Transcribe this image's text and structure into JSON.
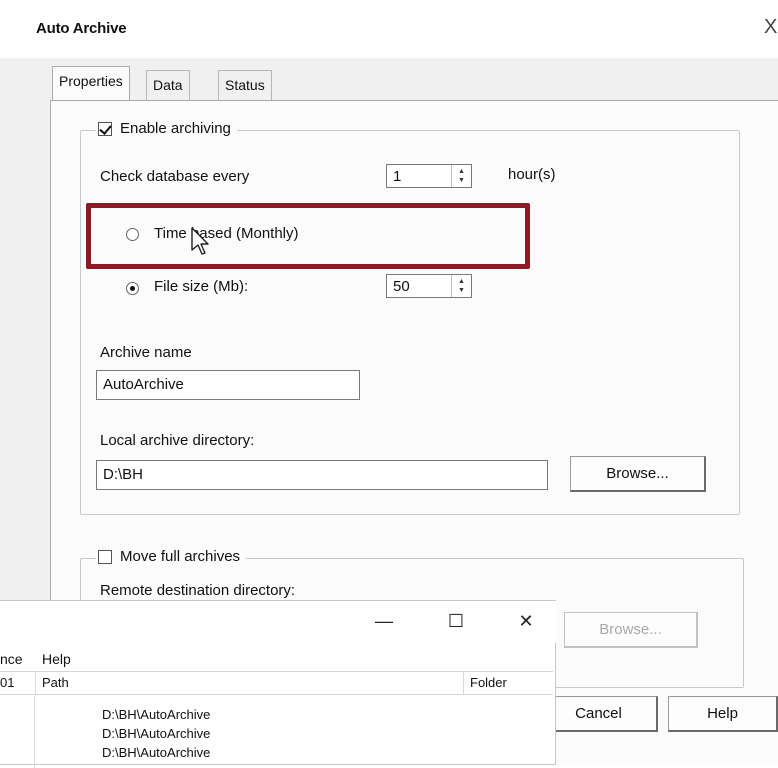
{
  "dialog": {
    "title": "Auto Archive",
    "close_glyph": "X",
    "tabs": [
      {
        "label": "Properties",
        "active": true
      },
      {
        "label": "Data",
        "active": false
      },
      {
        "label": "Status",
        "active": false
      }
    ],
    "archiving": {
      "enable_label": "Enable archiving",
      "enable_checked": true,
      "check_label": "Check database every",
      "check_value": "1",
      "check_unit": "hour(s)",
      "time_based_label": "Time based (Monthly)",
      "time_based_selected": false,
      "file_size_label": "File size (Mb):",
      "file_size_selected": true,
      "file_size_value": "50",
      "archive_name_label": "Archive name",
      "archive_name_value": "AutoArchive",
      "local_dir_label": "Local archive directory:",
      "local_dir_value": "D:\\BH",
      "browse_label": "Browse..."
    },
    "move": {
      "enable_label": "Move full archives",
      "enable_checked": false,
      "remote_label": "Remote destination directory:",
      "browse_label": "Browse..."
    },
    "buttons": {
      "cancel": "Cancel",
      "help": "Help"
    },
    "highlight_color": "#8b1a22"
  },
  "explorer": {
    "minimize_glyph": "—",
    "maximize_glyph": "☐",
    "close_glyph": "✕",
    "menu": [
      {
        "label": "nce"
      },
      {
        "label": "Help"
      }
    ],
    "columns": [
      {
        "label": "01"
      },
      {
        "label": "Path"
      },
      {
        "label": "Folder"
      }
    ],
    "rows": [
      {
        "path": "D:\\BH\\AutoArchive"
      },
      {
        "path": "D:\\BH\\AutoArchive"
      },
      {
        "path": "D:\\BH\\AutoArchive"
      }
    ]
  },
  "icons": {
    "cursor": "arrow-cursor-icon",
    "spin_up": "spin-up-icon",
    "spin_down": "spin-down-icon"
  }
}
